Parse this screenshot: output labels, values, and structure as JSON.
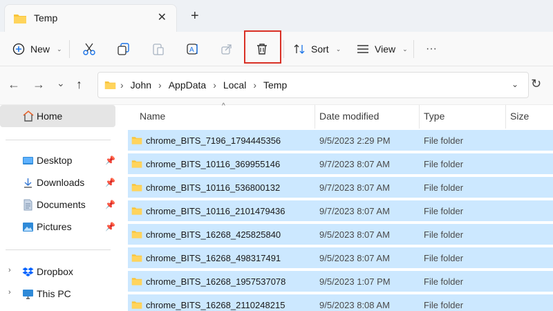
{
  "tab": {
    "title": "Temp",
    "close_glyph": "✕",
    "new_tab_glyph": "+"
  },
  "commandbar": {
    "new_label": "New",
    "sort_label": "Sort",
    "view_label": "View",
    "more_glyph": "···",
    "caret": "⌄"
  },
  "address": {
    "crumbs": [
      "John",
      "AppData",
      "Local",
      "Temp"
    ],
    "separator": "›"
  },
  "nav": {
    "back": "←",
    "forward": "→",
    "recent": "⌄",
    "up": "↑",
    "refresh": "↻"
  },
  "sidebar": {
    "home": "Home",
    "pinned": [
      "Desktop",
      "Downloads",
      "Documents",
      "Pictures"
    ],
    "locations": [
      "Dropbox",
      "This PC"
    ],
    "pin_glyph": "📌",
    "expand_glyph": "›"
  },
  "columns": {
    "name": "Name",
    "date": "Date modified",
    "type": "Type",
    "size": "Size",
    "sort_indicator": "^"
  },
  "files": [
    {
      "name": "chrome_BITS_7196_1794445356",
      "date": "9/5/2023 2:29 PM",
      "type": "File folder"
    },
    {
      "name": "chrome_BITS_10116_369955146",
      "date": "9/7/2023 8:07 AM",
      "type": "File folder"
    },
    {
      "name": "chrome_BITS_10116_536800132",
      "date": "9/7/2023 8:07 AM",
      "type": "File folder"
    },
    {
      "name": "chrome_BITS_10116_2101479436",
      "date": "9/7/2023 8:07 AM",
      "type": "File folder"
    },
    {
      "name": "chrome_BITS_16268_425825840",
      "date": "9/5/2023 8:07 AM",
      "type": "File folder"
    },
    {
      "name": "chrome_BITS_16268_498317491",
      "date": "9/5/2023 8:07 AM",
      "type": "File folder"
    },
    {
      "name": "chrome_BITS_16268_1957537078",
      "date": "9/5/2023 1:07 PM",
      "type": "File folder"
    },
    {
      "name": "chrome_BITS_16268_2110248215",
      "date": "9/5/2023 8:08 AM",
      "type": "File folder"
    }
  ],
  "colors": {
    "selection": "#cce8ff",
    "folder": "#f8c43a",
    "highlight_box": "#d93025",
    "accent_blue": "#1a73e8"
  },
  "icons": {
    "new": "plus-circle-icon",
    "cut": "scissors-icon",
    "copy": "copy-icon",
    "paste": "clipboard-icon",
    "rename": "rename-icon",
    "share": "share-icon",
    "delete": "trash-icon",
    "sort": "sort-arrows-icon",
    "view": "view-lines-icon"
  }
}
